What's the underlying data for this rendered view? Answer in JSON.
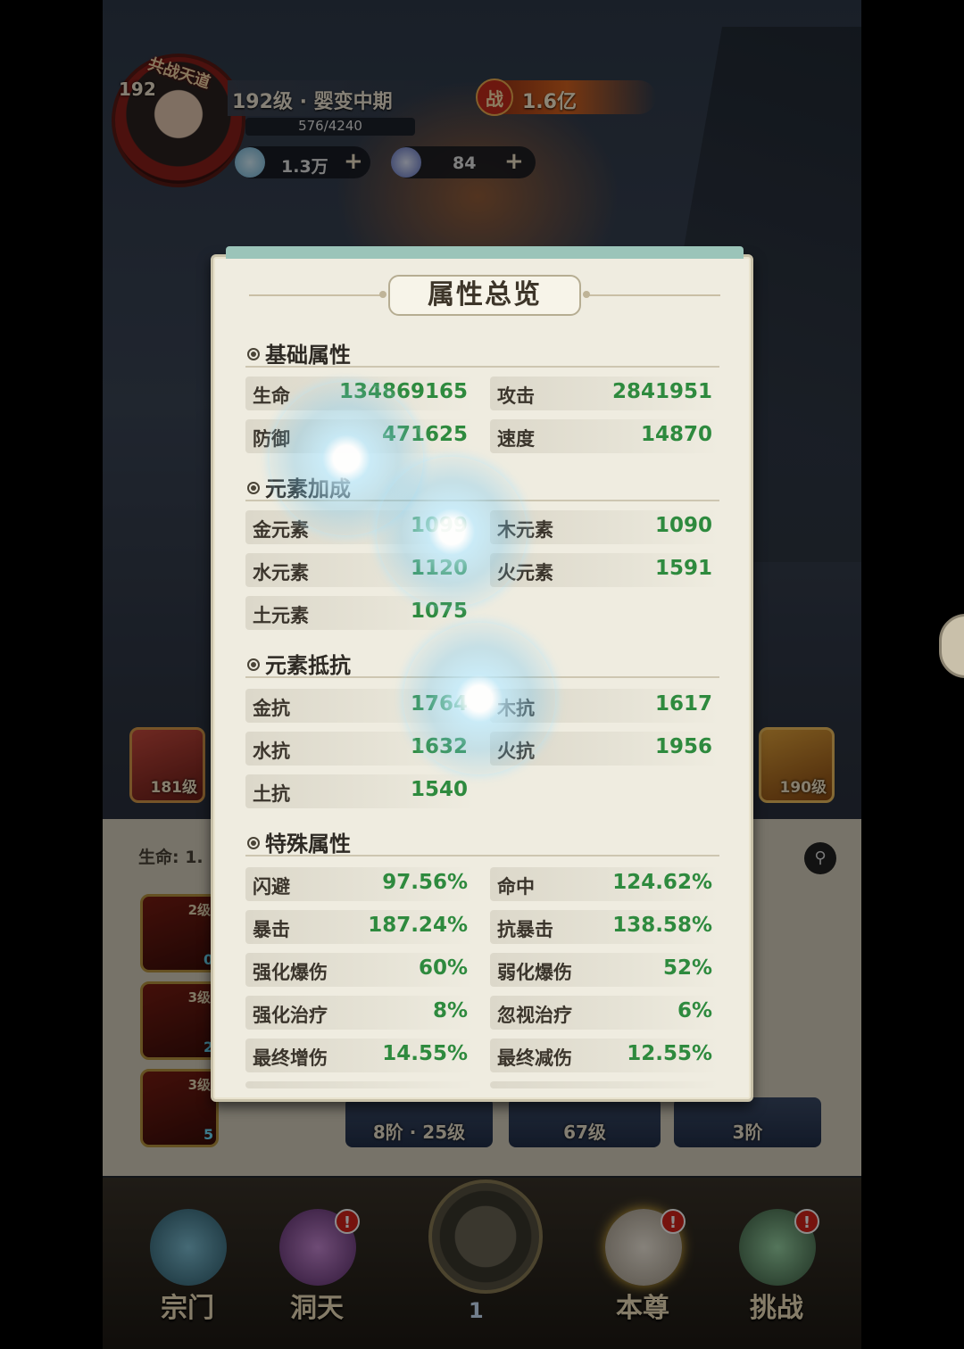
{
  "hud": {
    "avatar_level": "192",
    "avatar_tag": "共战天道",
    "title": "192级 · 婴变中期",
    "exp": "576/4240",
    "power_icon": "战",
    "power": "1.6亿",
    "gem_amount": "1.3万",
    "coin_amount": "84",
    "plus": "+"
  },
  "background": {
    "left_card_level": "181级",
    "right_card_level": "190级",
    "life_label": "生命: 1.",
    "search_icon": "search-icon",
    "skills": [
      {
        "level": "2级",
        "count": "0"
      },
      {
        "level": "3级",
        "count": "2"
      },
      {
        "level": "3级",
        "count": "5"
      }
    ],
    "cards": [
      "8阶 · 25级",
      "67级",
      "3阶"
    ]
  },
  "nav": {
    "items": [
      {
        "label": "宗门",
        "badge": ""
      },
      {
        "label": "洞天",
        "badge": "!"
      },
      {
        "label": "本尊",
        "badge": "!"
      },
      {
        "label": "挑战",
        "badge": "!"
      }
    ],
    "center_count": "1"
  },
  "modal": {
    "title": "属性总览",
    "sections": {
      "basic": {
        "title": "基础属性",
        "rows": [
          {
            "k": "生命",
            "v": "134869165"
          },
          {
            "k": "攻击",
            "v": "2841951"
          },
          {
            "k": "防御",
            "v": "471625"
          },
          {
            "k": "速度",
            "v": "14870"
          }
        ]
      },
      "element_bonus": {
        "title": "元素加成",
        "rows": [
          {
            "k": "金元素",
            "v": "1099"
          },
          {
            "k": "木元素",
            "v": "1090"
          },
          {
            "k": "水元素",
            "v": "1120"
          },
          {
            "k": "火元素",
            "v": "1591"
          },
          {
            "k": "土元素",
            "v": "1075"
          }
        ]
      },
      "element_resist": {
        "title": "元素抵抗",
        "rows": [
          {
            "k": "金抗",
            "v": "1764"
          },
          {
            "k": "木抗",
            "v": "1617"
          },
          {
            "k": "水抗",
            "v": "1632"
          },
          {
            "k": "火抗",
            "v": "1956"
          },
          {
            "k": "土抗",
            "v": "1540"
          }
        ]
      },
      "special": {
        "title": "特殊属性",
        "rows": [
          {
            "k": "闪避",
            "v": "97.56%"
          },
          {
            "k": "命中",
            "v": "124.62%"
          },
          {
            "k": "暴击",
            "v": "187.24%"
          },
          {
            "k": "抗暴击",
            "v": "138.58%"
          },
          {
            "k": "强化爆伤",
            "v": "60%"
          },
          {
            "k": "弱化爆伤",
            "v": "52%"
          },
          {
            "k": "强化治疗",
            "v": "8%"
          },
          {
            "k": "忽视治疗",
            "v": "6%"
          },
          {
            "k": "最终增伤",
            "v": "14.55%"
          },
          {
            "k": "最终减伤",
            "v": "12.55%"
          }
        ]
      }
    }
  },
  "colors": {
    "value_green": "#2e8a3e",
    "panel_bg": "#efece0",
    "label_dark": "#3b352c"
  }
}
